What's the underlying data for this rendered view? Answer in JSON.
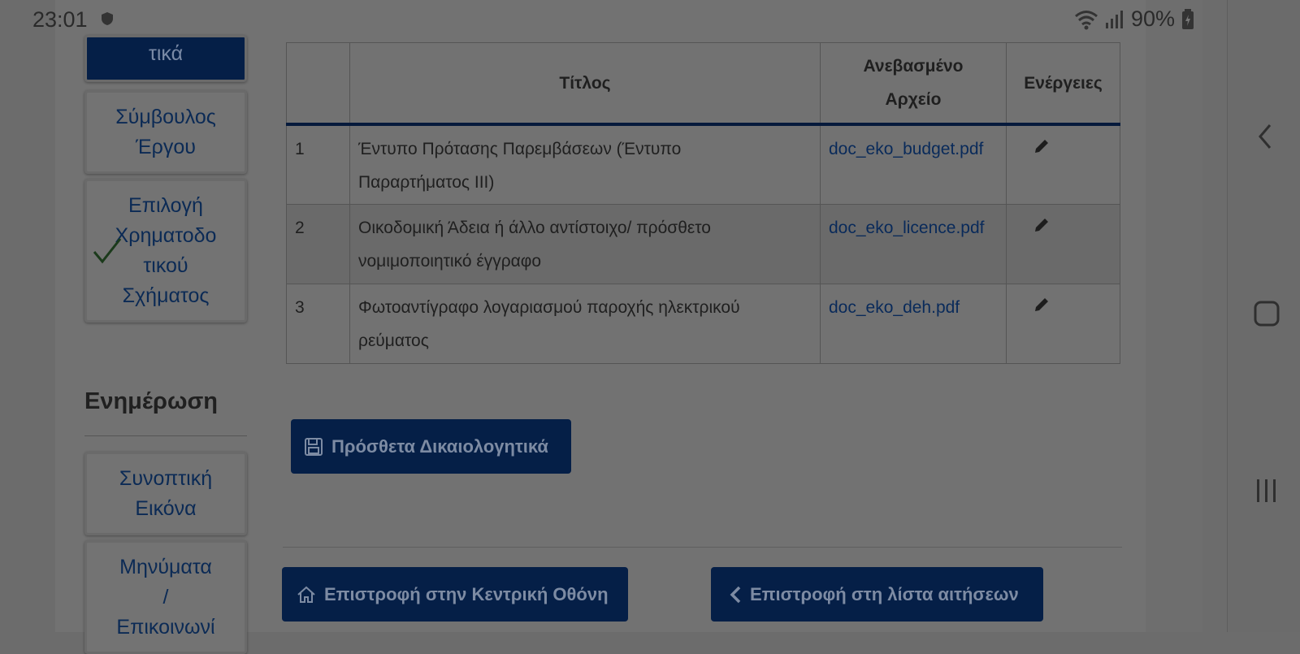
{
  "status_bar": {
    "time": "23:01",
    "battery": "90%",
    "icons": [
      "shield-icon",
      "wifi-icon",
      "signal-icon",
      "battery-icon"
    ]
  },
  "sidebar": {
    "items": [
      {
        "label_lines": [
          "τικά"
        ],
        "active": true
      },
      {
        "label_lines": [
          "Σύμβουλος",
          "Έργου"
        ],
        "active": false
      },
      {
        "label_lines": [
          "Επιλογή",
          "Χρηματοδο",
          "τικού",
          "Σχήματος"
        ],
        "active": false,
        "checked": true
      },
      {
        "label_lines": [
          "Συνοπτική",
          "Εικόνα"
        ],
        "active": false
      },
      {
        "label_lines": [
          "Μηνύματα",
          "/",
          "Επικοινωνί"
        ],
        "active": false
      }
    ],
    "section_heading": "Ενημέρωση"
  },
  "table": {
    "headers": {
      "number": "",
      "title": "Τίτλος",
      "uploaded_file_line1": "Ανεβασμένο",
      "uploaded_file_line2": "Αρχείο",
      "actions": "Ενέργειες"
    },
    "rows": [
      {
        "number": "1",
        "title_line1": "Έντυπο Πρότασης Παρεμβάσεων (Έντυπο",
        "title_line2": "Παραρτήματος ΙΙΙ)",
        "file": "doc_eko_budget.pdf",
        "action_icon": "pencil-icon"
      },
      {
        "number": "2",
        "title_line1": "Οικοδομική Άδεια ή άλλο αντίστοιχο/ πρόσθετο",
        "title_line2": "νομιμοποιητικό έγγραφο",
        "file": "doc_eko_licence.pdf",
        "action_icon": "pencil-icon"
      },
      {
        "number": "3",
        "title_line1": "Φωτοαντίγραφο λογαριασμού παροχής ηλεκτρικού",
        "title_line2": "ρεύματος",
        "file": "doc_eko_deh.pdf",
        "action_icon": "pencil-icon"
      }
    ]
  },
  "buttons": {
    "extra_documents": "Πρόσθετα Δικαιολογητικά",
    "home": "Επιστροφή στην Κεντρική Οθόνη",
    "back_to_list": "Επιστροφή στη λίστα αιτήσεων"
  },
  "colors": {
    "primary": "#051f47",
    "link": "#092a5a",
    "overlay_background": "#727272"
  }
}
